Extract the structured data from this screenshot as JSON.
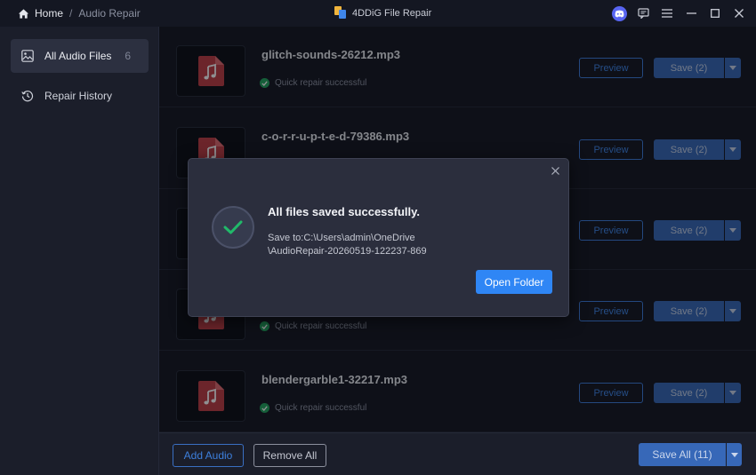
{
  "titlebar": {
    "breadcrumb_home": "Home",
    "breadcrumb_sep": "/",
    "breadcrumb_current": "Audio Repair",
    "app_title": "4DDiG File Repair",
    "icons": [
      "discord-icon",
      "feedback-icon",
      "menu-icon",
      "minimize-icon",
      "maximize-icon",
      "close-icon"
    ]
  },
  "sidebar": {
    "items": [
      {
        "label": "All Audio Files",
        "count": "6",
        "icon": "image-icon",
        "active": true
      },
      {
        "label": "Repair History",
        "count": "",
        "icon": "history-icon",
        "active": false
      }
    ]
  },
  "files": [
    {
      "name": "glitch-sounds-26212.mp3",
      "status": "Quick repair successful",
      "preview": "Preview",
      "save": "Save (2)"
    },
    {
      "name": "c-o-r-r-u-p-t-e-d-79386.mp3",
      "status": "",
      "preview": "Preview",
      "save": "Save (2)"
    },
    {
      "name": "",
      "status": "",
      "preview": "Preview",
      "save": "Save (2)"
    },
    {
      "name": "",
      "status": "Quick repair successful",
      "preview": "Preview",
      "save": "Save (2)"
    },
    {
      "name": "blendergarble1-32217.mp3",
      "status": "Quick repair successful",
      "preview": "Preview",
      "save": "Save (2)"
    }
  ],
  "footer": {
    "add_audio": "Add Audio",
    "remove_all": "Remove All",
    "save_all": "Save All (11)"
  },
  "dialog": {
    "title": "All files saved successfully.",
    "path_line1": "Save to:C:\\Users\\admin\\OneDrive",
    "path_line2": "\\AudioRepair-20260519-122237-869",
    "open_folder": "Open Folder"
  },
  "colors": {
    "background": "#141722",
    "sidebar": "#1b1e2a",
    "accent_blue": "#3768b8",
    "open_folder_blue": "#2f86f5",
    "audio_icon_red": "#c03c44",
    "success_green": "#21a45e"
  }
}
